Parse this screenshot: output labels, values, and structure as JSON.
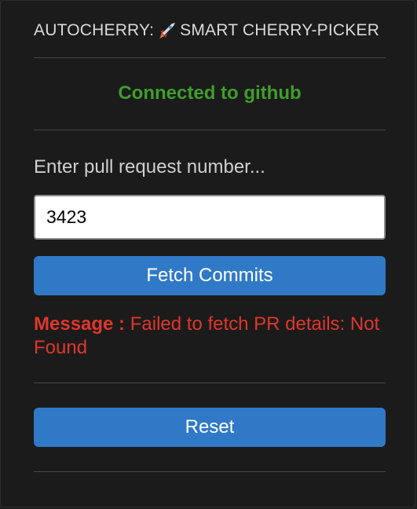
{
  "header": {
    "title_prefix": "AUTOCHERRY:",
    "title_suffix": "SMART CHERRY-PICKER",
    "title_icon": "rocket-icon"
  },
  "status": {
    "text": "Connected to github",
    "color": "#3f9e2b"
  },
  "form": {
    "prompt_label": "Enter pull request number...",
    "pr_input_value": "3423",
    "fetch_button_label": "Fetch Commits"
  },
  "message": {
    "label": "Message :",
    "text": "Failed to fetch PR details: Not Found",
    "color": "#e0362b"
  },
  "actions": {
    "reset_button_label": "Reset"
  },
  "colors": {
    "background": "#1b1b1b",
    "button": "#3079c6",
    "divider": "#474747"
  }
}
